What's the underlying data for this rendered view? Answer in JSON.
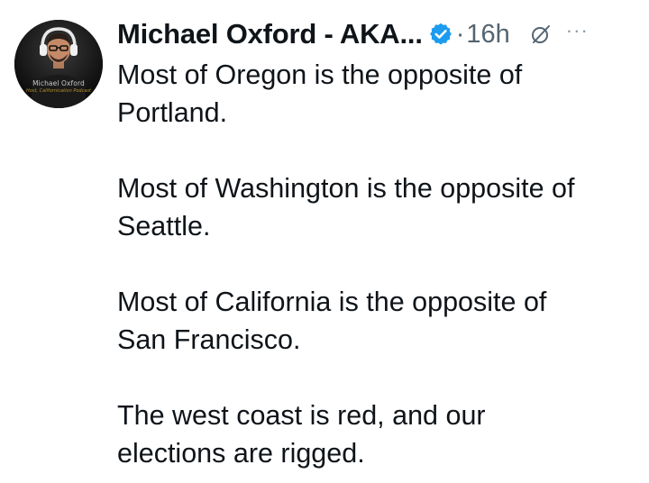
{
  "author": {
    "display_name": "Michael Oxford - AKA...",
    "avatar_caption_name": "Michael Oxford",
    "avatar_caption_sub": "Host, Californication Podcast"
  },
  "meta": {
    "separator": "·",
    "timestamp": "16h",
    "more_label": "···"
  },
  "icons": {
    "verified": "verified-badge-icon",
    "grok": "grok-icon",
    "more": "more-options-icon"
  },
  "colors": {
    "text": "#0f1419",
    "secondary": "#536471",
    "verified": "#1d9bf0",
    "background": "#ffffff"
  },
  "post": {
    "paragraphs": [
      {
        "lines": [
          "Most of Oregon is the opposite of",
          "Portland."
        ]
      },
      {
        "lines": [
          "Most of Washington is the opposite of",
          "Seattle."
        ]
      },
      {
        "lines": [
          "Most of California is the opposite of",
          "San Francisco."
        ]
      },
      {
        "lines": [
          "The west coast is red, and our",
          "elections are rigged."
        ]
      }
    ]
  }
}
